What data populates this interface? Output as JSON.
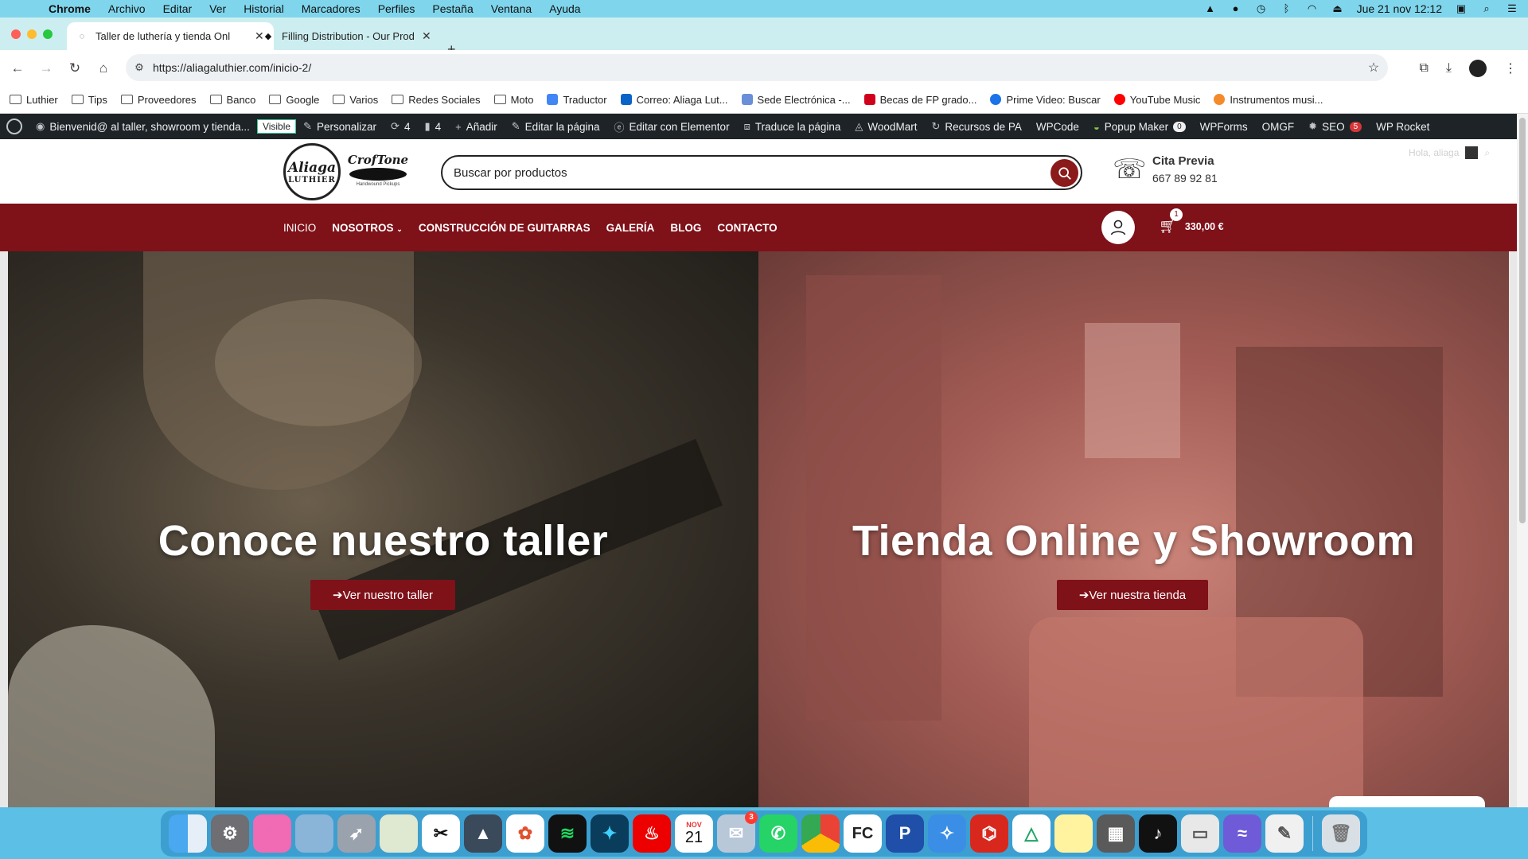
{
  "menubar": {
    "app": "Chrome",
    "items": [
      "Archivo",
      "Editar",
      "Ver",
      "Historial",
      "Marcadores",
      "Perfiles",
      "Pestaña",
      "Ventana",
      "Ayuda"
    ],
    "clock": "Jue 21 nov  12:12"
  },
  "tabs": [
    {
      "title": "Taller de luthería y tienda Onl",
      "active": true
    },
    {
      "title": "Filling Distribution - Our Prod",
      "active": false
    }
  ],
  "toolbar": {
    "url": "https://aliagaluthier.com/inicio-2/"
  },
  "bookmarks": [
    {
      "label": "Luthier",
      "type": "folder"
    },
    {
      "label": "Tips",
      "type": "folder"
    },
    {
      "label": "Proveedores",
      "type": "folder"
    },
    {
      "label": "Banco",
      "type": "folder"
    },
    {
      "label": "Google",
      "type": "folder"
    },
    {
      "label": "Varios",
      "type": "folder"
    },
    {
      "label": "Redes Sociales",
      "type": "folder"
    },
    {
      "label": "Moto",
      "type": "folder"
    },
    {
      "label": "Traductor",
      "type": "site",
      "color": "#4285f4"
    },
    {
      "label": "Correo: Aliaga Lut...",
      "type": "site",
      "color": "#0a64c8"
    },
    {
      "label": "Sede Electrónica -...",
      "type": "site",
      "color": "#6a8fd8"
    },
    {
      "label": "Becas de FP grado...",
      "type": "site",
      "color": "#d0021b"
    },
    {
      "label": "Prime Video: Buscar",
      "type": "site",
      "color": "#1a73e8"
    },
    {
      "label": "YouTube Music",
      "type": "site",
      "color": "#ff0000"
    },
    {
      "label": "Instrumentos musi...",
      "type": "site",
      "color": "#f58a2a"
    }
  ],
  "wpbar": {
    "site": "Bienvenid@ al taller, showroom y tienda...",
    "visible": "Visible",
    "customize": "Personalizar",
    "updates": "4",
    "comments": "4",
    "add": "Añadir",
    "edit_page": "Editar la página",
    "elementor": "Editar con Elementor",
    "translate": "Traduce la página",
    "woodmart": "WoodMart",
    "pa": "Recursos de PA",
    "wpcode": "WPCode",
    "popup": "Popup Maker",
    "popup_count": "0",
    "wpforms": "WPForms",
    "omgf": "OMGF",
    "seo": "SEO",
    "seo_count": "5",
    "rocket": "WP Rocket"
  },
  "header": {
    "logo_main": "Aliaga",
    "logo_sub": "LUTHIER",
    "logo2": "CrofTone",
    "logo2_sub": "Handwound Pickups",
    "search_placeholder": "Buscar por productos",
    "cita_title": "Cita Previa",
    "cita_phone": "667 89 92 81",
    "hola": "Hola, aliaga"
  },
  "nav": {
    "links": [
      "INICIO",
      "NOSOTROS",
      "CONSTRUCCIÓN DE GUITARRAS",
      "GALERÍA",
      "BLOG",
      "CONTACTO"
    ],
    "cart_count": "1",
    "cart_total": "330,00 €"
  },
  "hero": {
    "left_title": "Conoce nuestro taller",
    "left_button": "➔Ver nuestro taller",
    "right_title": "Tienda Online y Showroom",
    "right_button": "➔Ver nuestra tienda"
  },
  "dock": {
    "calendar_month": "NOV",
    "calendar_day": "21",
    "mail_badge": "3"
  }
}
